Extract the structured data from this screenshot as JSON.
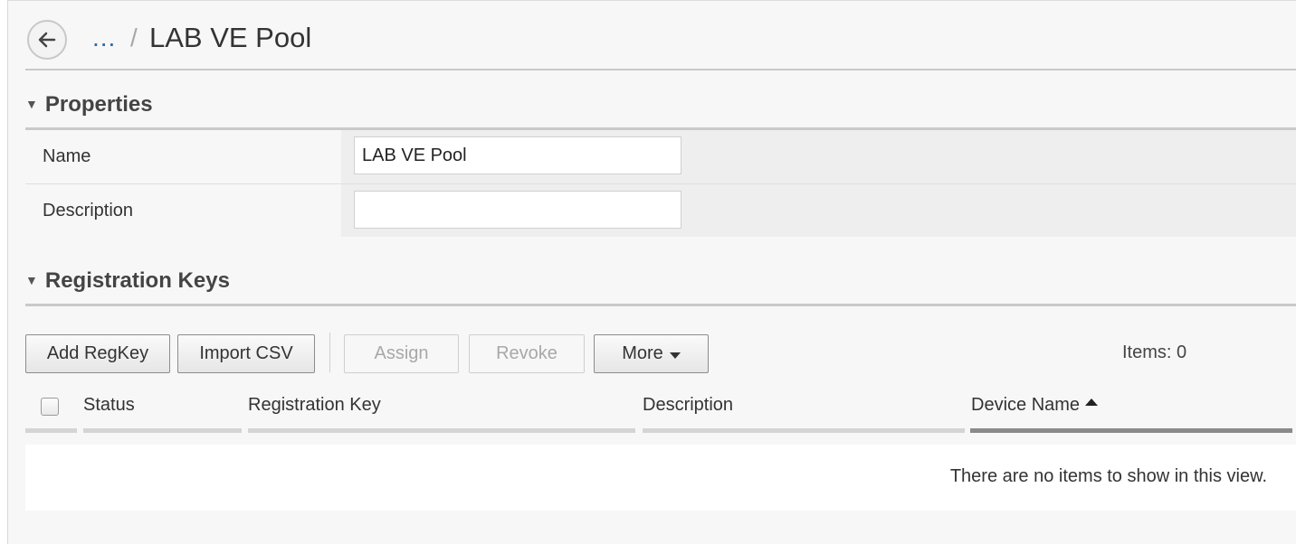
{
  "header": {
    "breadcrumb_ellipsis": "...",
    "breadcrumb_separator": "/",
    "title": "LAB VE Pool"
  },
  "properties": {
    "section_title": "Properties",
    "fields": [
      {
        "label": "Name",
        "value": "LAB VE Pool",
        "placeholder": ""
      },
      {
        "label": "Description",
        "value": "",
        "placeholder": ""
      }
    ]
  },
  "registration_keys": {
    "section_title": "Registration Keys",
    "toolbar": {
      "add_regkey": "Add RegKey",
      "import_csv": "Import CSV",
      "assign": "Assign",
      "revoke": "Revoke",
      "more": "More"
    },
    "items_count": "Items: 0",
    "table": {
      "columns": [
        "Status",
        "Registration Key",
        "Description",
        "Device Name"
      ],
      "sorted_column": "Device Name",
      "sort_direction": "ascending",
      "rows": [],
      "empty_message": "There are no items to show in this view."
    }
  },
  "icons": {
    "back": "arrow-left-icon",
    "section_toggle": "triangle-down-icon",
    "more_caret": "caret-down-icon",
    "sort": "sort-ascending-icon"
  },
  "colors": {
    "link": "#2b6aa6",
    "section_rule": "#c9c9c9",
    "sorted_bar": "#8a8a8a"
  }
}
